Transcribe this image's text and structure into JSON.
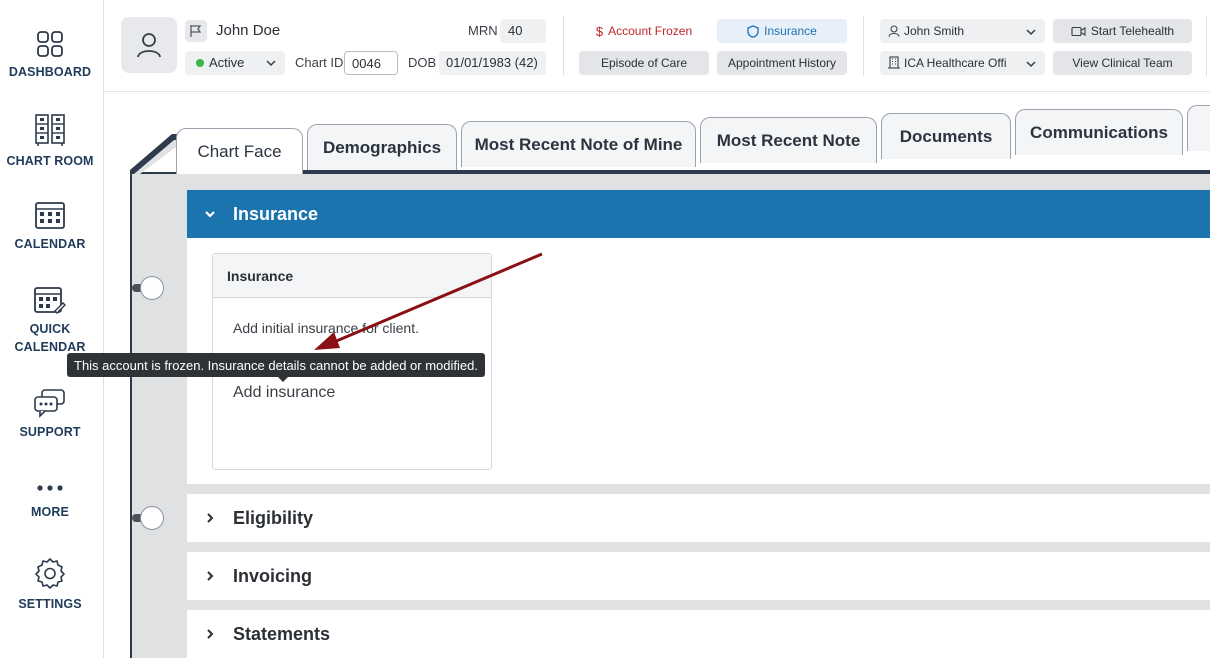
{
  "nav": {
    "dashboard": "DASHBOARD",
    "chart_room": "CHART ROOM",
    "calendar": "CALENDAR",
    "quick_calendar": "QUICK CALENDAR",
    "support": "SUPPORT",
    "more": "MORE",
    "settings": "SETTINGS"
  },
  "patient": {
    "name": "John Doe",
    "mrn_label": "MRN",
    "mrn": "40",
    "status": "Active",
    "chart_id_label": "Chart ID",
    "chart_id": "0046",
    "dob_label": "DOB",
    "dob": "01/01/1983 (42)"
  },
  "header": {
    "account_frozen": "Account Frozen",
    "insurance": "Insurance",
    "episode_of_care": "Episode of Care",
    "appointment_history": "Appointment History",
    "clinician": "John Smith",
    "office": "ICA Healthcare Offi",
    "start_telehealth": "Start Telehealth",
    "view_clinical_team": "View Clinical Team"
  },
  "tabs": [
    {
      "label": "Chart Face",
      "active": true
    },
    {
      "label": "Demographics",
      "active": false
    },
    {
      "label": "Most Recent Note of Mine",
      "active": false
    },
    {
      "label": "Most Recent Note",
      "active": false
    },
    {
      "label": "Documents",
      "active": false
    },
    {
      "label": "Communications",
      "active": false
    }
  ],
  "sections": {
    "insurance": "Insurance",
    "eligibility": "Eligibility",
    "invoicing": "Invoicing",
    "statements": "Statements"
  },
  "insurance_card": {
    "title": "Insurance",
    "message": "Add initial insurance for client.",
    "add_link": "Add insurance"
  },
  "tooltip": "This account is frozen. Insurance details cannot be added or modified.",
  "colors": {
    "section_header": "#1c74ae",
    "frozen_red": "#c0262a",
    "insurance_blue": "#1f73b6",
    "annotation_arrow": "#8b1014",
    "status_active": "#3bb24a"
  }
}
